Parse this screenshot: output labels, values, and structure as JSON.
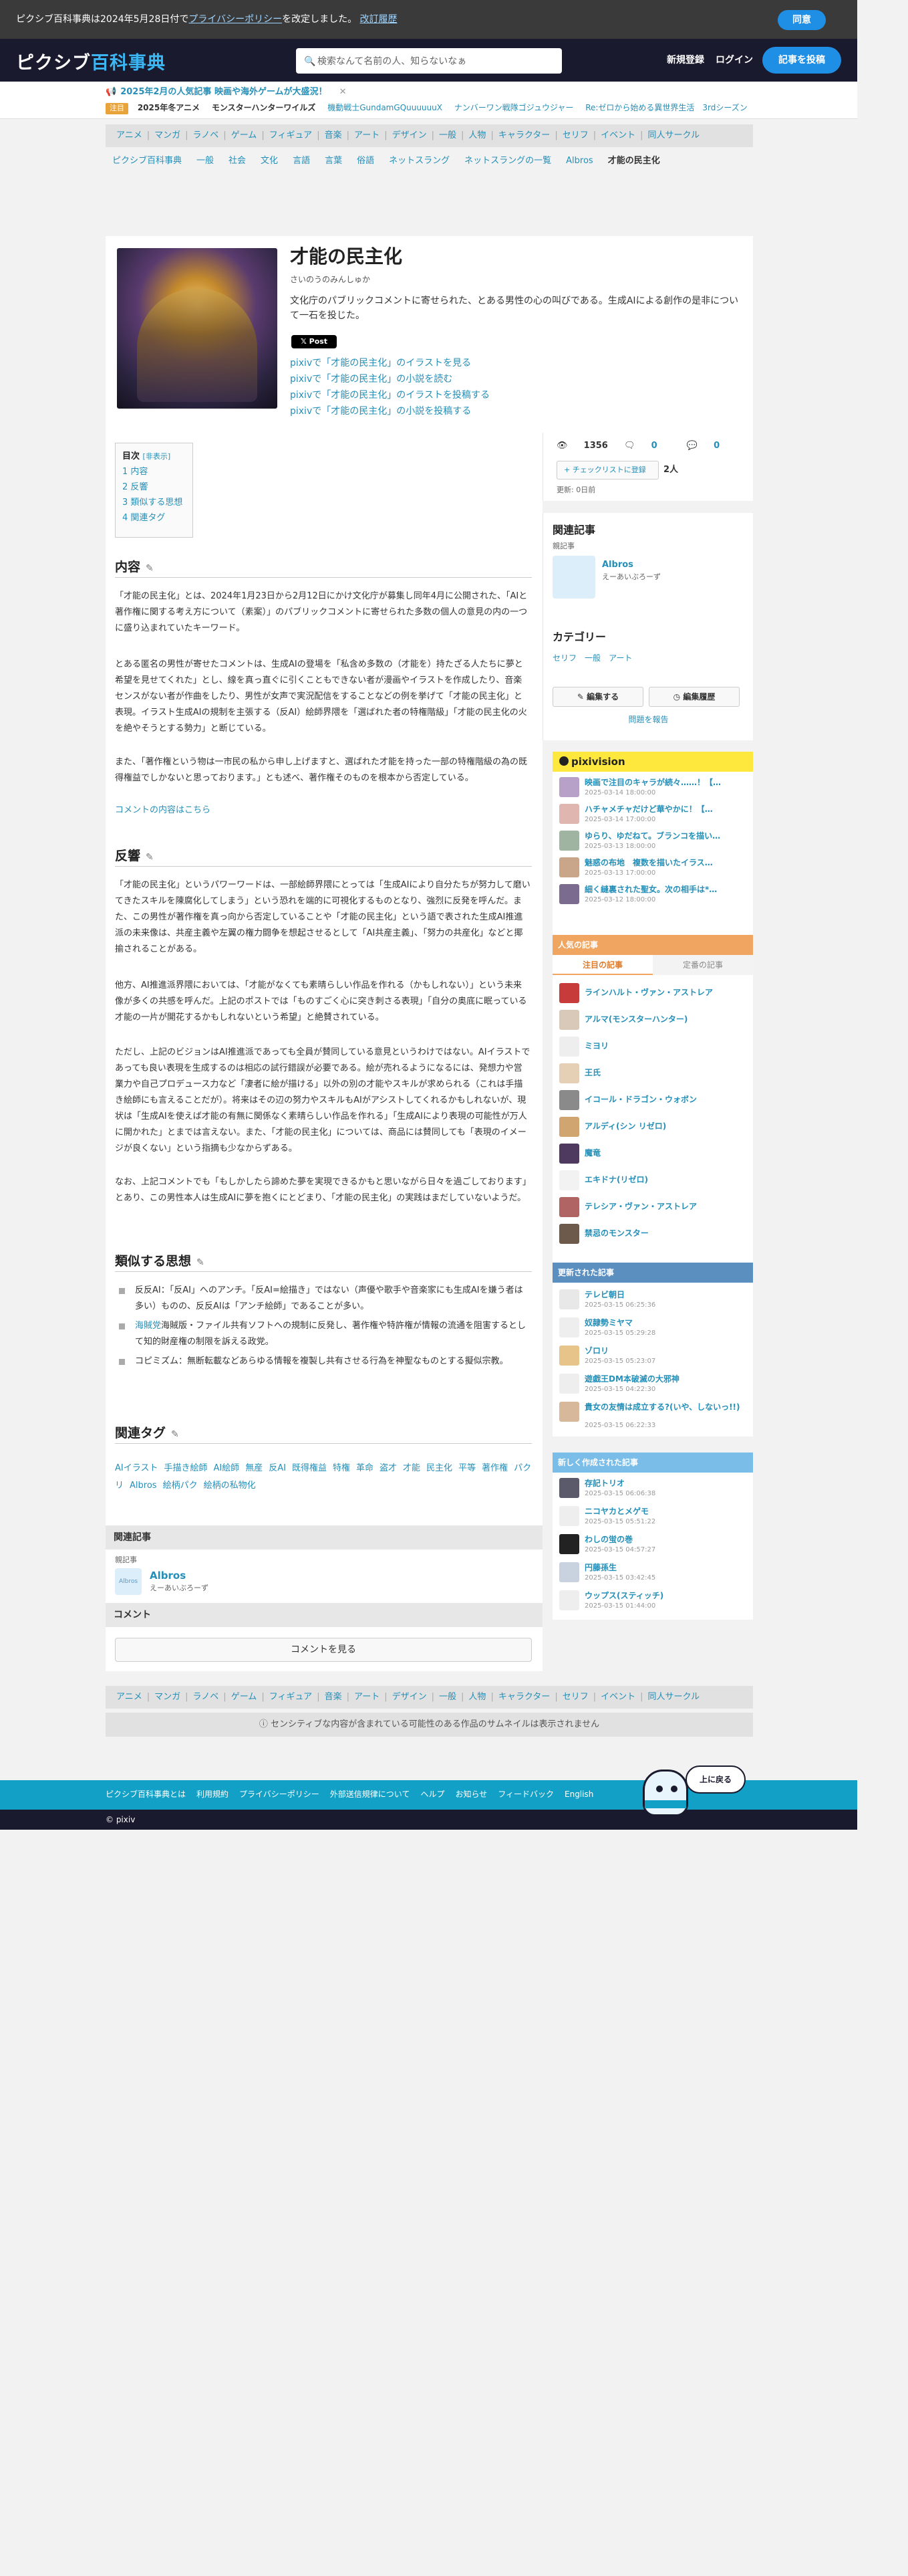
{
  "cookie": {
    "pre": "ピクシブ百科事典は2024年5月28日付で",
    "link": "プライバシーポリシー",
    "mid": "を改定しました。",
    "hist": "改訂履歴",
    "agree": "同意"
  },
  "header": {
    "logo_a": "ピクシブ",
    "logo_b": "百科事典",
    "search_placeholder": "検索なんて名前の人、知らないなぁ",
    "register": "新規登録",
    "login": "ログイン",
    "write": "記事を投稿"
  },
  "news": {
    "headline": "2025年2月の人気記事 映画や海外ゲームが大盛況！",
    "tag": "注目",
    "items": [
      "2025年冬アニメ",
      "モンスターハンターワイルズ",
      "機動戦士GundamGQuuuuuuX",
      "ナンバーワン戦隊ゴジュウジャー",
      "Re:ゼロから始める異世界生活　3rdシーズン"
    ]
  },
  "categories": [
    "アニメ",
    "マンガ",
    "ラノベ",
    "ゲーム",
    "フィギュア",
    "音楽",
    "アート",
    "デザイン",
    "一般",
    "人物",
    "キャラクター",
    "セリフ",
    "イベント",
    "同人サークル"
  ],
  "breadcrumb": [
    "ピクシブ百科事典",
    "一般",
    "社会",
    "文化",
    "言語",
    "言葉",
    "俗語",
    "ネットスラング",
    "ネットスラングの一覧",
    "Albros",
    "才能の民主化"
  ],
  "article": {
    "title": "才能の民主化",
    "reading": "さいのうのみんしゅか",
    "summary": "文化庁のパブリックコメントに寄せられた、とある男性の心の叫びである。生成AIによる創作の是非について一石を投じた。",
    "xpost": "𝕏 Post",
    "pixiv_links": [
      "pixivで「才能の民主化」のイラストを見る",
      "pixivで「才能の民主化」の小説を読む",
      "pixivで「才能の民主化」のイラストを投稿する",
      "pixivで「才能の民主化」の小説を投稿する"
    ]
  },
  "toc": {
    "title": "目次",
    "hide": "[非表示]",
    "items": [
      "1 内容",
      "2 反響",
      "3 類似する思想",
      "4 関連タグ"
    ]
  },
  "sections": {
    "content": "内容",
    "reaction": "反響",
    "similar": "類似する思想",
    "tags": "関連タグ"
  },
  "content_paras": [
    "「才能の民主化」とは、2024年1月23日から2月12日にかけ文化庁が募集し同年4月に公開された、「AIと著作権に関する考え方について（素案）」のパブリックコメントに寄せられた多数の個人の意見の内の一つに盛り込まれていたキーワード。",
    "とある匿名の男性が寄せたコメントは、生成AIの登場を「私含め多数の（才能を）持たざる人たちに夢と希望を見せてくれた」とし、線を真っ直ぐに引くこともできない者が漫画やイラストを作成したり、音楽センスがない者が作曲をしたり、男性が女声で実況配信をすることなどの例を挙げて「才能の民主化」と表現。イラスト生成AIの規制を主張する（反AI）絵師界隈を「選ばれた者の特権階級」「才能の民主化の火を絶やそうとする勢力」と断じている。",
    "また、「著作権という物は一市民の私から申し上げますと、選ばれた才能を持った一部の特権階級の為の既得権益でしかないと思っております。」とも述べ、著作権そのものを根本から否定している。",
    "コメントの内容はこちら"
  ],
  "reaction_paras": [
    "「才能の民主化」というパワーワードは、一部絵師界隈にとっては「生成AIにより自分たちが努力して磨いてきたスキルを陳腐化してしまう」という恐れを端的に可視化するものとなり、強烈に反発を呼んだ。また、この男性が著作権を真っ向から否定していることや「才能の民主化」という語で表された生成AI推進派の未来像は、共産主義や左翼の権力闘争を想起させるとして「AI共産主義」、「努力の共産化」などと揶揄されることがある。",
    "他方、AI推進派界隈においては、「才能がなくても素晴らしい作品を作れる（かもしれない）」という未来像が多くの共感を呼んだ。上記のポストでは「ものすごく心に突き刺さる表現」「自分の奥底に眠っている才能の一片が開花するかもしれないという希望」と絶賛されている。",
    "ただし、上記のビジョンはAI推進派であっても全員が賛同している意見というわけではない。AIイラストであっても良い表現を生成するのは相応の試行錯誤が必要である。絵が売れるようになるには、発想力や営業力や自己プロデュース力など「凄者に絵が描ける」以外の別の才能やスキルが求められる（これは手描き絵師にも言えることだが）。将来はその辺の努力やスキルもAIがアシストしてくれるかもしれないが、現状は「生成AIを使えば才能の有無に関係なく素晴らしい作品を作れる」「生成AIにより表現の可能性が万人に開かれた」とまでは言えない。また、「才能の民主化」については、商品には賛同しても「表現のイメージが良くない」という指摘も少なからずある。",
    "なお、上記コメントでも「もしかしたら諦めた夢を実現できるかもと思いながら日々を過ごしております」とあり、この男性本人は生成AIに夢を抱くにとどまり、「才能の民主化」の実践はまだしていないようだ。"
  ],
  "similar_items": [
    "反反AI：「反AI」へのアンチ。「反AI=絵描き」ではない（声優や歌手や音楽家にも生成AIを嫌う者は多い）ものの、反反AIは「アンチ絵師」であることが多い。",
    "海賊版・ファイル共有ソフトへの規制に反発し、著作権や特許権が情報の流通を阻害するとして知的財産権の制限を訴える政党。",
    "コピミズム：無断転載などあらゆる情報を複製し共有させる行為を神聖なものとする擬似宗教。"
  ],
  "similar_names": [
    "海賊党"
  ],
  "tags": [
    "AIイラスト",
    "手描き絵師",
    "AI絵師",
    "無産",
    "反AI",
    "既得権益",
    "特権",
    "革命",
    "盗才",
    "才能",
    "民主化",
    "平等",
    "著作権",
    "パクリ",
    "Albros",
    "絵柄パク",
    "絵柄の私物化"
  ],
  "related": {
    "header": "関連記事",
    "type": "親記事",
    "name": "Albros",
    "reading": "えーあいぶろーず",
    "thumb_label": "Albros"
  },
  "comments": {
    "header": "コメント",
    "button": "コメントを見る"
  },
  "stats": {
    "views": "1356",
    "c1": "0",
    "c2": "0",
    "checklist": "チェックリストに登録",
    "count": "2人",
    "updated": "更新: 0日前"
  },
  "side_related": {
    "title": "関連記事",
    "type": "親記事",
    "name": "Albros",
    "reading": "えーあいぶろーず"
  },
  "side_category": {
    "title": "カテゴリー",
    "items": [
      "セリフ",
      "一般",
      "アート"
    ],
    "edit": "編集する",
    "history": "編集履歴",
    "report": "問題を報告"
  },
  "pixivision": {
    "title": "pixivision",
    "items": [
      {
        "t": "映画で注目のキャラが続々……！【…",
        "d": "2025-03-14 18:00:00"
      },
      {
        "t": "ハチャメチャだけど華やかに！【…",
        "d": "2025-03-14 17:00:00"
      },
      {
        "t": "ゆらり、ゆだねて。ブランコを描い…",
        "d": "2025-03-13 18:00:00"
      },
      {
        "t": "魅惑の布地　複数を描いたイラス…",
        "d": "2025-03-13 17:00:00"
      },
      {
        "t": "細く縫裏された聖女。次の相手は*…",
        "d": "2025-03-12 18:00:00"
      }
    ]
  },
  "popular": {
    "title": "人気の記事",
    "tab1": "注目の記事",
    "tab2": "定番の記事",
    "items": [
      "ラインハルト・ヴァン・アストレア",
      "アルマ(モンスターハンター)",
      "ミヨリ",
      "王氏",
      "イコール・ドラゴン・ウォボン",
      "アルディ(シン リゼロ)",
      "魔竜",
      "エキドナ(リゼロ)",
      "テレシア・ヴァン・アストレア",
      "禁忌のモンスター"
    ]
  },
  "updated": {
    "title": "更新された記事",
    "items": [
      {
        "t": "テレビ朝日",
        "d": "2025-03-15 06:25:36"
      },
      {
        "t": "奴隷勢ミヤマ",
        "d": "2025-03-15 05:29:28"
      },
      {
        "t": "ゾロリ",
        "d": "2025-03-15 05:23:07"
      },
      {
        "t": "遊戯王DM本破滅の大邪神",
        "d": "2025-03-15 04:22:30"
      },
      {
        "t": "貴女の友情は成立する?(いや、しないっ!!)",
        "d": "2025-03-15 06:22:33"
      }
    ]
  },
  "newest": {
    "title": "新しく作成された記事",
    "items": [
      {
        "t": "存記トリオ",
        "d": "2025-03-15 06:06:38"
      },
      {
        "t": "ニコヤカとメゲモ",
        "d": "2025-03-15 05:51:22"
      },
      {
        "t": "わしの蛍の巻",
        "d": "2025-03-15 04:57:27"
      },
      {
        "t": "円藤孫生",
        "d": "2025-03-15 03:42:45"
      },
      {
        "t": "ウップス(スティッチ)",
        "d": "2025-03-15 01:44:00"
      }
    ]
  },
  "nsfw_notice": "センシティブな内容が含まれている可能性のある作品のサムネイルは表示されません",
  "footer": {
    "links": [
      "ピクシブ百科事典とは",
      "利用規約",
      "プライバシーポリシー",
      "外部送信規律について",
      "ヘルプ",
      "お知らせ",
      "フィードバック",
      "English"
    ],
    "copyright": "© pixiv",
    "totop": "上に戻る"
  }
}
